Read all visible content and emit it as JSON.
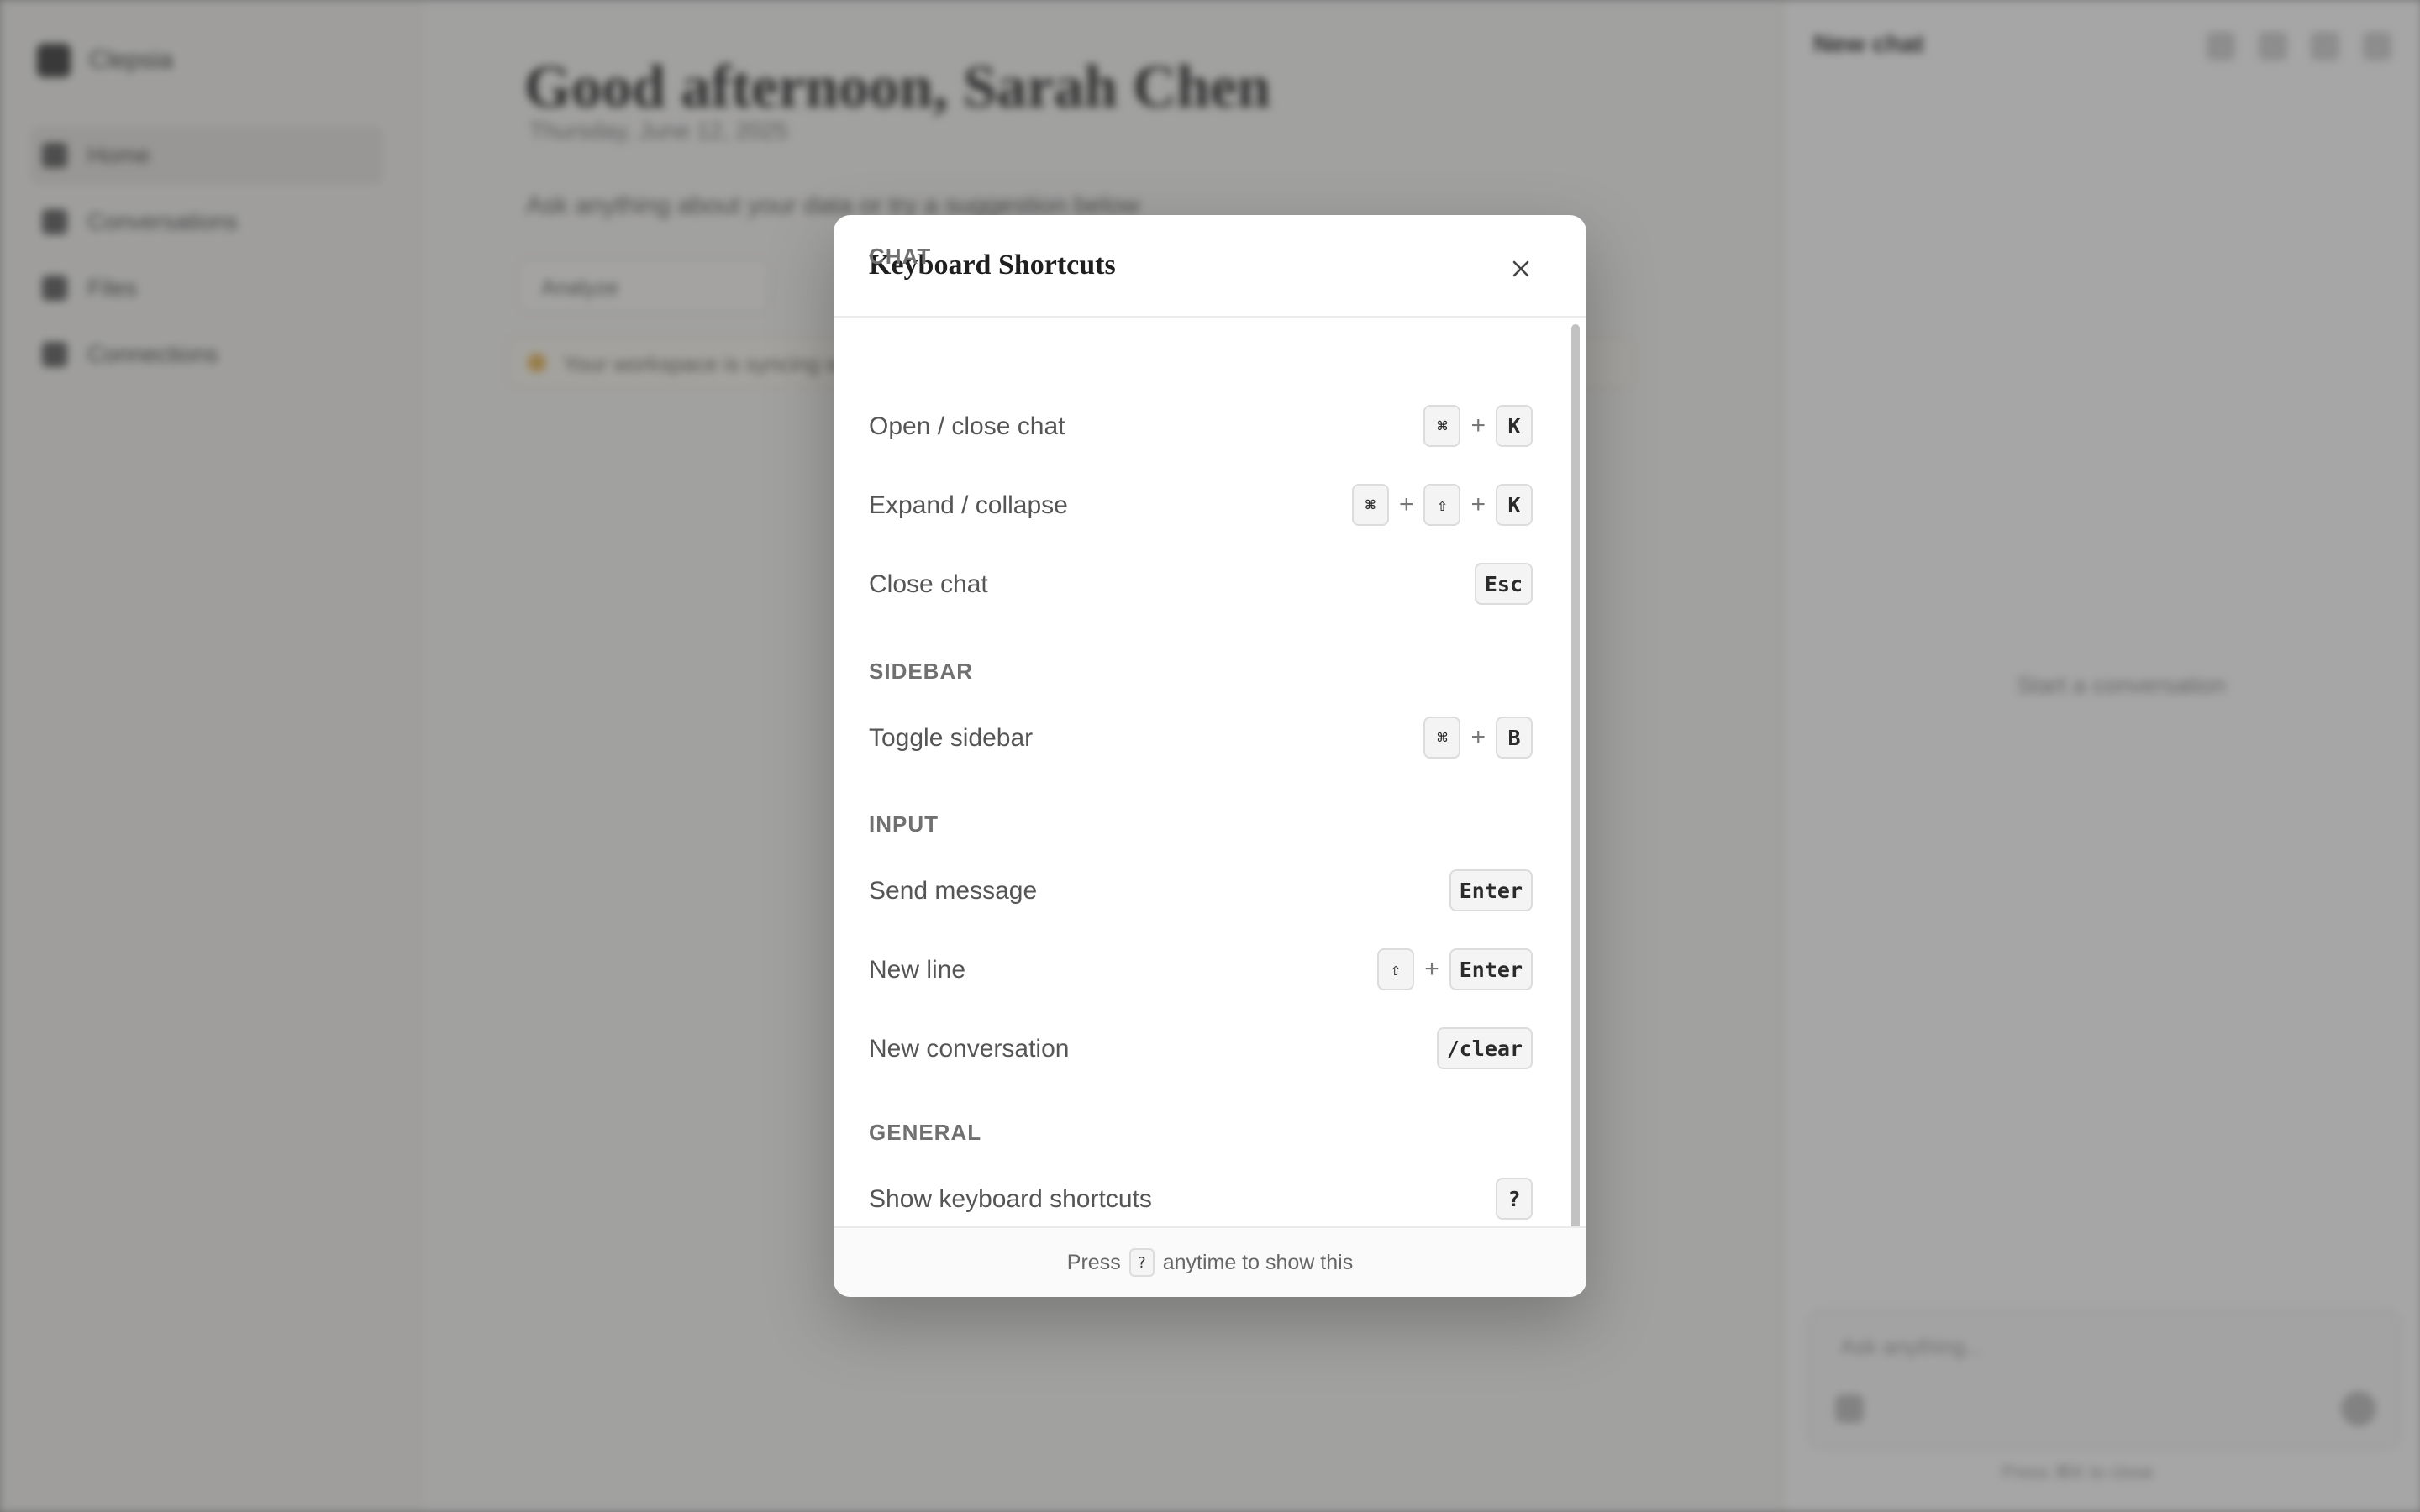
{
  "app": {
    "brand": "Clepsia",
    "nav": [
      {
        "label": "Home",
        "icon": "home-icon"
      },
      {
        "label": "Conversations",
        "icon": "chat-icon"
      },
      {
        "label": "Files",
        "icon": "folder-icon"
      },
      {
        "label": "Connections",
        "icon": "link-icon"
      }
    ],
    "greeting": "Good afternoon, Sarah Chen",
    "subtitle": "Thursday, June 12, 2025",
    "prompt": "Ask anything about your data or try a suggestion below",
    "chip": "Analyze",
    "notice": "Your workspace is syncing with connected sources",
    "chat": {
      "title": "New chat",
      "empty": "Start a conversation",
      "input_placeholder": "Ask anything...",
      "footer": "Press ⌘K to close"
    }
  },
  "modal": {
    "title": "Keyboard Shortcuts",
    "close_label": "×",
    "sections": [
      {
        "title": "CHAT",
        "rows": [
          {
            "label": "Open / close chat",
            "keys": [
              "⌘",
              "K"
            ]
          },
          {
            "label": "Expand / collapse",
            "keys": [
              "⌘",
              "⇧",
              "K"
            ]
          },
          {
            "label": "Close chat",
            "keys": [
              "Esc"
            ]
          }
        ]
      },
      {
        "title": "SIDEBAR",
        "rows": [
          {
            "label": "Toggle sidebar",
            "keys": [
              "⌘",
              "B"
            ]
          }
        ]
      },
      {
        "title": "INPUT",
        "rows": [
          {
            "label": "Send message",
            "keys": [
              "Enter"
            ]
          },
          {
            "label": "New line",
            "keys": [
              "⇧",
              "Enter"
            ]
          },
          {
            "label": "New conversation",
            "keys": [
              "/clear"
            ]
          }
        ]
      },
      {
        "title": "GENERAL",
        "rows": [
          {
            "label": "Show keyboard shortcuts",
            "keys": [
              "?"
            ]
          }
        ]
      }
    ],
    "footer": {
      "prefix": "Press",
      "key": "?",
      "suffix": "anytime to show this"
    }
  },
  "colors": {
    "overlay": "#5a5a58",
    "modal_bg": "#ffffff",
    "section_title": "#707070",
    "label": "#555555",
    "kbd_bg": "#f4f4f4",
    "kbd_border": "#dcdcdc"
  }
}
